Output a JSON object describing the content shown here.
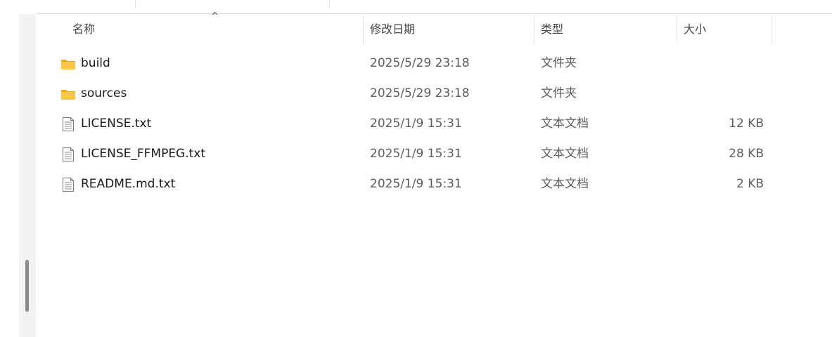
{
  "header": {
    "sort_indicator": "^",
    "columns": [
      {
        "key": "name",
        "label": "名称"
      },
      {
        "key": "date",
        "label": "修改日期"
      },
      {
        "key": "type",
        "label": "类型"
      },
      {
        "key": "size",
        "label": "大小"
      }
    ]
  },
  "files": [
    {
      "name": "build",
      "date": "2025/5/29 23:18",
      "type": "文件夹",
      "size": "",
      "icon": "folder-icon"
    },
    {
      "name": "sources",
      "date": "2025/5/29 23:18",
      "type": "文件夹",
      "size": "",
      "icon": "folder-icon"
    },
    {
      "name": "LICENSE.txt",
      "date": "2025/1/9 15:31",
      "type": "文本文档",
      "size": "12 KB",
      "icon": "text-file-icon"
    },
    {
      "name": "LICENSE_FFMPEG.txt",
      "date": "2025/1/9 15:31",
      "type": "文本文档",
      "size": "28 KB",
      "icon": "text-file-icon"
    },
    {
      "name": "README.md.txt",
      "date": "2025/1/9 15:31",
      "type": "文本文档",
      "size": "2 KB",
      "icon": "text-file-icon"
    }
  ],
  "colors": {
    "folder": "#f8c74a",
    "folder_dark": "#e8a820",
    "text_secondary": "#5d5d5d"
  }
}
